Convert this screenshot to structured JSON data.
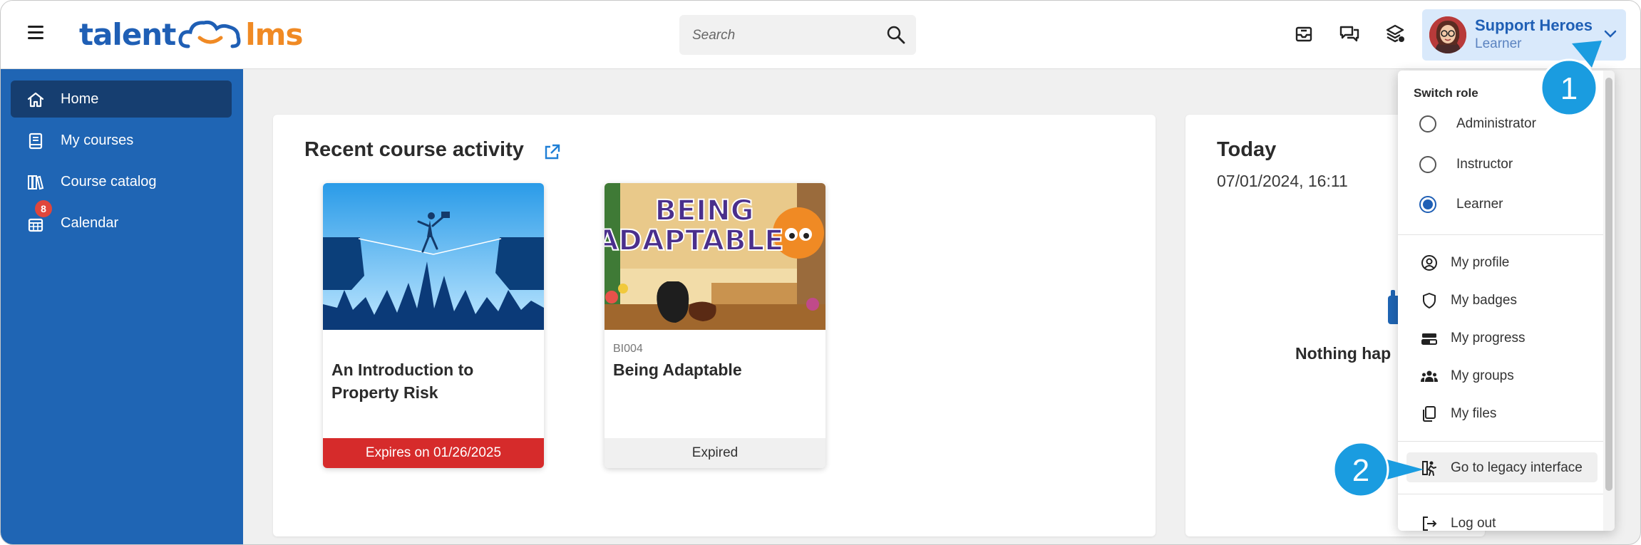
{
  "header": {
    "logo_left": "talent",
    "logo_right": "lms",
    "search_placeholder": "Search",
    "user": {
      "name": "Support Heroes",
      "role": "Learner"
    }
  },
  "sidebar": {
    "items": [
      {
        "label": "Home",
        "icon": "home-icon",
        "active": true
      },
      {
        "label": "My courses",
        "icon": "book-icon"
      },
      {
        "label": "Course catalog",
        "icon": "catalog-icon"
      },
      {
        "label": "Calendar",
        "icon": "calendar-icon",
        "badge": "8"
      }
    ]
  },
  "recent": {
    "title": "Recent course activity",
    "courses": [
      {
        "code": "",
        "name": "An Introduction to Property Risk",
        "footer": "Expires on 01/26/2025",
        "footer_color": "#d62b2b"
      },
      {
        "code": "BI004",
        "name": "Being Adaptable",
        "footer": "Expired",
        "footer_color": "#f0f0f0",
        "thumb_text": [
          "BEING",
          "ADAPTABLE"
        ]
      }
    ]
  },
  "today": {
    "title": "Today",
    "datetime": "07/01/2024, 16:11",
    "empty_text": "Nothing hap"
  },
  "dropdown": {
    "switch_role_label": "Switch role",
    "roles": [
      {
        "label": "Administrator",
        "checked": false
      },
      {
        "label": "Instructor",
        "checked": false
      },
      {
        "label": "Learner",
        "checked": true
      }
    ],
    "menu": [
      {
        "label": "My profile",
        "icon": "user-circle-icon"
      },
      {
        "label": "My badges",
        "icon": "shield-icon"
      },
      {
        "label": "My progress",
        "icon": "progress-icon"
      },
      {
        "label": "My groups",
        "icon": "group-icon"
      },
      {
        "label": "My files",
        "icon": "files-icon"
      }
    ],
    "legacy_label": "Go to legacy interface",
    "logout_label": "Log out"
  },
  "callouts": [
    "1",
    "2"
  ],
  "colors": {
    "brand_blue": "#1f65b4",
    "brand_orange": "#f08a24",
    "callout": "#1a9ce0"
  }
}
